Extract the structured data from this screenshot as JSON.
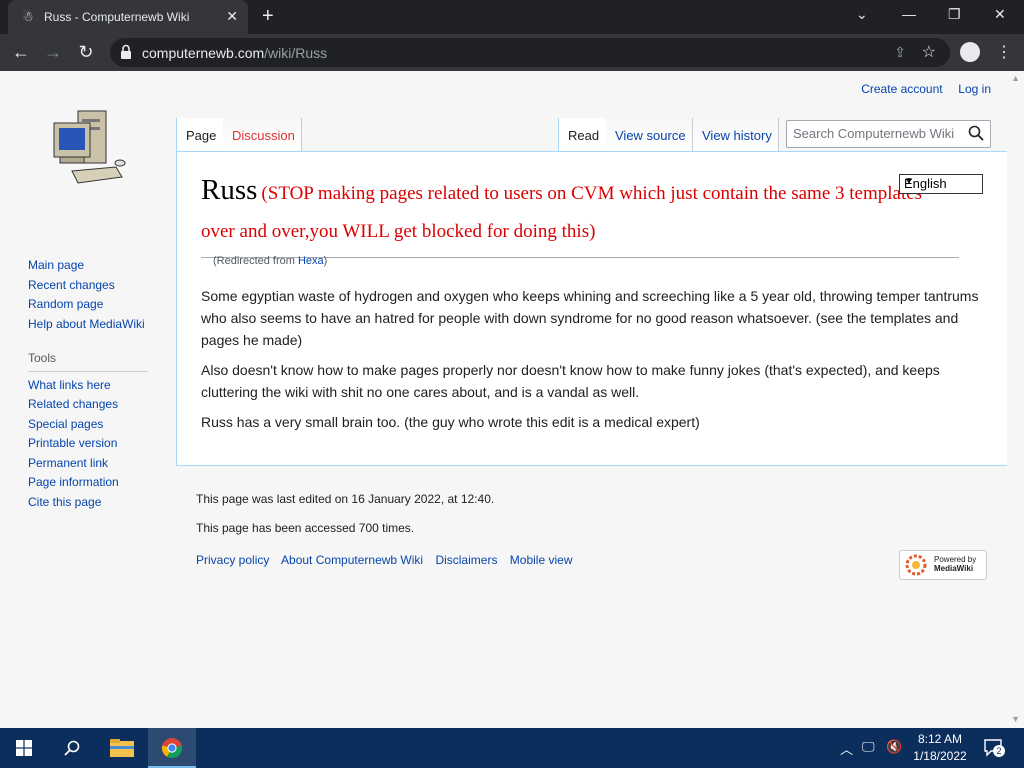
{
  "browser": {
    "tab_title": "Russ - Computernewb Wiki",
    "url_host": "computernewb.com",
    "url_path": "/wiki/Russ"
  },
  "wiki": {
    "personal": {
      "create_account": "Create account",
      "log_in": "Log in"
    },
    "navigation": [
      "Main page",
      "Recent changes",
      "Random page",
      "Help about MediaWiki"
    ],
    "tools_heading": "Tools",
    "tools": [
      "What links here",
      "Related changes",
      "Special pages",
      "Printable version",
      "Permanent link",
      "Page information",
      "Cite this page"
    ],
    "tabs": {
      "page": "Page",
      "discussion": "Discussion",
      "read": "Read",
      "view_source": "View source",
      "view_history": "View history"
    },
    "search_placeholder": "Search Computernewb Wiki",
    "language": "English",
    "heading_name": "Russ",
    "heading_note": "(STOP making pages related to users on CVM which just contain the same 3 templates over and over,you WILL get blocked for doing this)",
    "redirect_prefix": "(Redirected from ",
    "redirect_link": "Hexa",
    "redirect_suffix": ")",
    "paragraphs": [
      "Some egyptian waste of hydrogen and oxygen who keeps whining and screeching like a 5 year old, throwing temper tantrums who also seems to have an hatred for people with down syndrome for no good reason whatsoever. (see the templates and pages he made)",
      "Also doesn't know how to make pages properly nor doesn't know how to make funny jokes (that's expected), and keeps cluttering the wiki with shit no one cares about, and is a vandal as well.",
      "Russ has a very small brain too. (the guy who wrote this edit is a medical expert)"
    ],
    "footer_edited": "This page was last edited on 16 January 2022, at 12:40.",
    "footer_accessed": "This page has been accessed 700 times.",
    "footer_links": [
      "Privacy policy",
      "About Computernewb Wiki",
      "Disclaimers",
      "Mobile view"
    ],
    "powered_line1": "Powered by",
    "powered_line2": "MediaWiki"
  },
  "taskbar": {
    "time": "8:12 AM",
    "date": "1/18/2022",
    "notification_count": "2"
  },
  "colors": {
    "link": "#0645ad",
    "warning_red": "#dd0000",
    "chrome_dark": "#202124",
    "taskbar": "#0b2e5c"
  }
}
